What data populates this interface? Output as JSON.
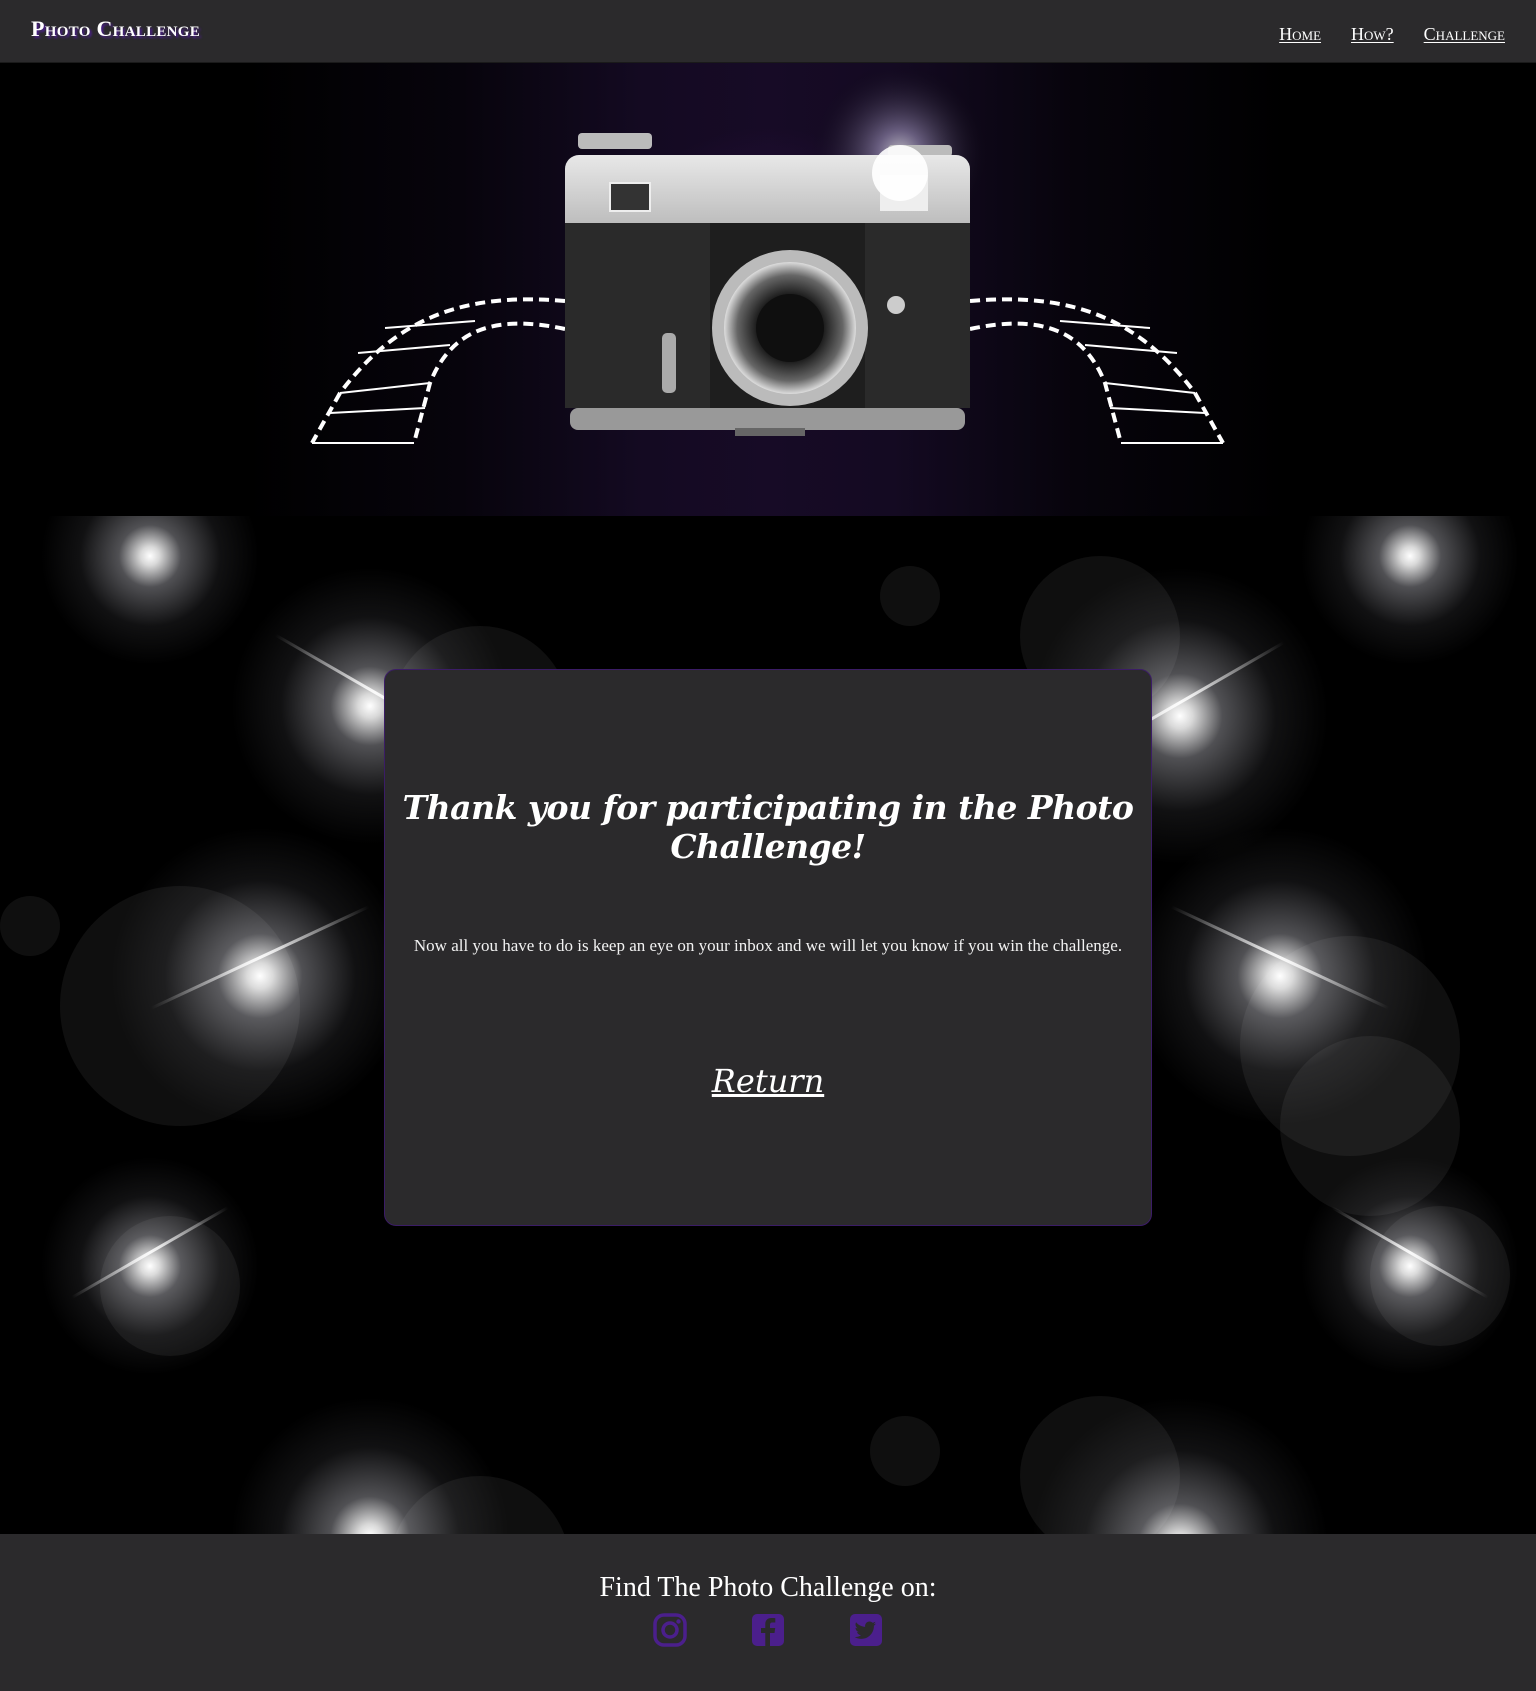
{
  "navbar": {
    "brand": "Photo Challenge",
    "links": [
      {
        "label": "Home"
      },
      {
        "label": "How?"
      },
      {
        "label": "Challenge"
      }
    ]
  },
  "hero": {
    "image": "camera-with-film-strip"
  },
  "card": {
    "title": "Thank you for participating in the Photo Challenge!",
    "message": "Now all you have to do is keep an eye on your inbox and we will let you know if you win the challenge.",
    "return_label": "Return"
  },
  "footer": {
    "title": "Find The Photo Challenge on:",
    "social": [
      {
        "icon": "instagram-icon"
      },
      {
        "icon": "facebook-icon"
      },
      {
        "icon": "twitter-icon"
      }
    ]
  },
  "colors": {
    "surface": "#2b2a2c",
    "accent": "#4b1f8c",
    "background": "#000000",
    "text": "#ffffff"
  }
}
